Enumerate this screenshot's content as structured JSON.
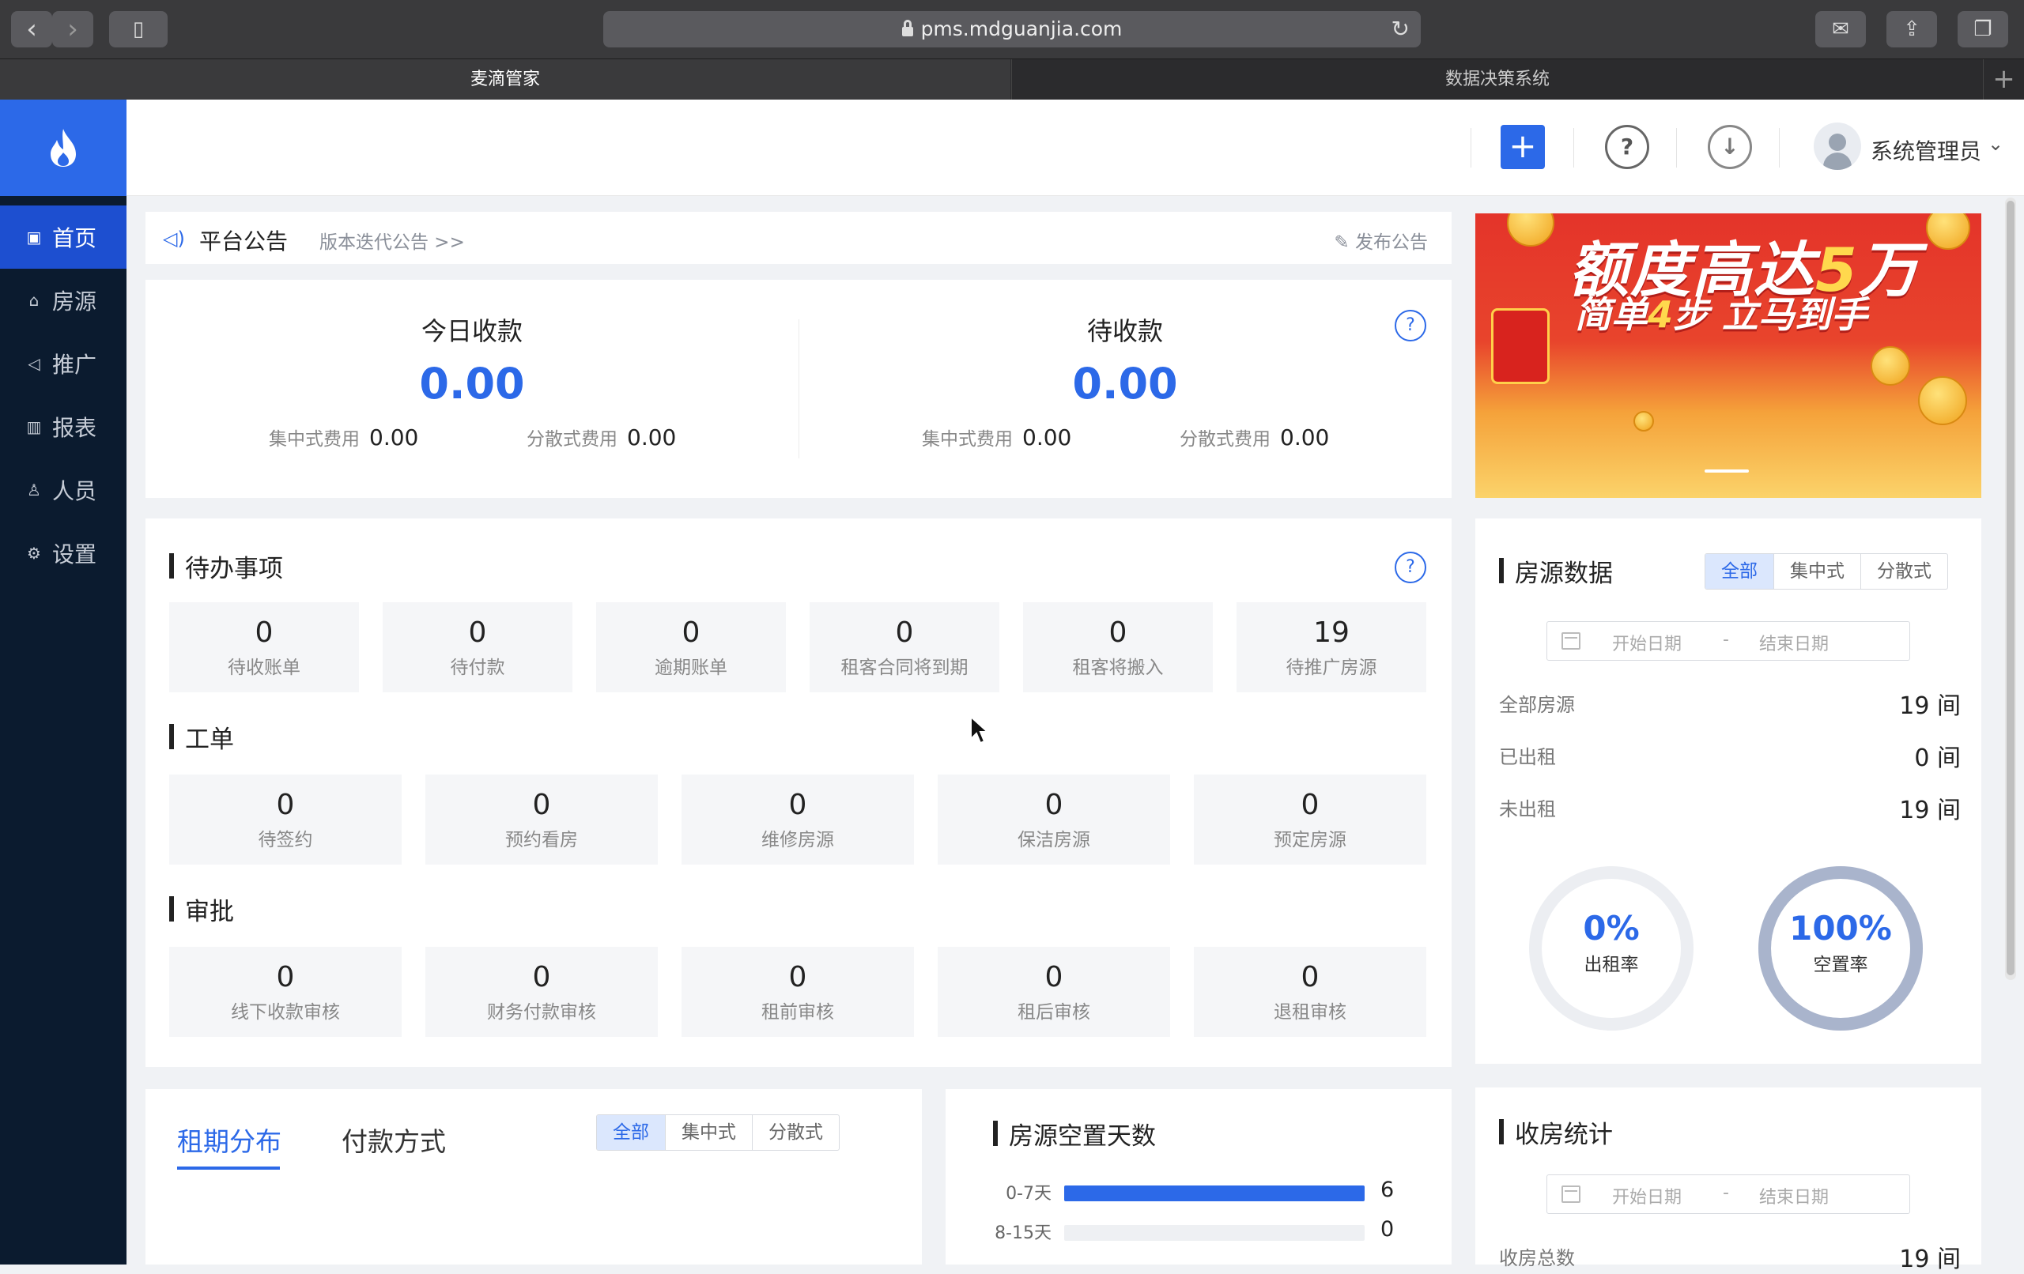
{
  "browser": {
    "url": "pms.mdguanjia.com",
    "tabs": [
      "麦滴管家",
      "数据决策系统"
    ]
  },
  "sidebar": {
    "items": [
      {
        "label": "首页",
        "icon": "dashboard-icon"
      },
      {
        "label": "房源",
        "icon": "home-icon"
      },
      {
        "label": "推广",
        "icon": "megaphone-icon"
      },
      {
        "label": "报表",
        "icon": "bar-chart-icon"
      },
      {
        "label": "人员",
        "icon": "user-icon"
      },
      {
        "label": "设置",
        "icon": "gear-icon"
      }
    ]
  },
  "header": {
    "user_name": "系统管理员"
  },
  "notice": {
    "title": "平台公告",
    "link": "版本迭代公告 >>",
    "publish": "发布公告"
  },
  "income": {
    "today": {
      "title": "今日收款",
      "value": "0.00",
      "central_label": "集中式费用",
      "central_value": "0.00",
      "scattered_label": "分散式费用",
      "scattered_value": "0.00"
    },
    "pending": {
      "title": "待收款",
      "value": "0.00",
      "central_label": "集中式费用",
      "central_value": "0.00",
      "scattered_label": "分散式费用",
      "scattered_value": "0.00"
    }
  },
  "banner": {
    "line1_a": "额度高达",
    "line1_b": "5",
    "line1_c": "万",
    "line2_a": "简单",
    "line2_b": "4",
    "line2_c": "步 立马到手"
  },
  "todo": {
    "title": "待办事项",
    "items": [
      {
        "value": "0",
        "label": "待收账单"
      },
      {
        "value": "0",
        "label": "待付款"
      },
      {
        "value": "0",
        "label": "逾期账单"
      },
      {
        "value": "0",
        "label": "租客合同将到期"
      },
      {
        "value": "0",
        "label": "租客将搬入"
      },
      {
        "value": "19",
        "label": "待推广房源"
      }
    ]
  },
  "workorder": {
    "title": "工单",
    "items": [
      {
        "value": "0",
        "label": "待签约"
      },
      {
        "value": "0",
        "label": "预约看房"
      },
      {
        "value": "0",
        "label": "维修房源"
      },
      {
        "value": "0",
        "label": "保洁房源"
      },
      {
        "value": "0",
        "label": "预定房源"
      }
    ]
  },
  "approval": {
    "title": "审批",
    "items": [
      {
        "value": "0",
        "label": "线下收款审核"
      },
      {
        "value": "0",
        "label": "财务付款审核"
      },
      {
        "value": "0",
        "label": "租前审核"
      },
      {
        "value": "0",
        "label": "租后审核"
      },
      {
        "value": "0",
        "label": "退租审核"
      }
    ]
  },
  "house_data": {
    "title": "房源数据",
    "filters": [
      "全部",
      "集中式",
      "分散式"
    ],
    "date_start": "开始日期",
    "date_sep": "-",
    "date_end": "结束日期",
    "rows": [
      {
        "label": "全部房源",
        "value": "19 间"
      },
      {
        "label": "已出租",
        "value": "0 间"
      },
      {
        "label": "未出租",
        "value": "19 间"
      }
    ],
    "occupancy": {
      "percent": "0%",
      "label": "出租率",
      "fraction": 0
    },
    "vacancy": {
      "percent": "100%",
      "label": "空置率",
      "fraction": 1
    },
    "colors": {
      "ring_track": "#eceef2",
      "ring_fill": "#a9b4cc"
    }
  },
  "lease": {
    "tabs": [
      "租期分布",
      "付款方式"
    ],
    "filters": [
      "全部",
      "集中式",
      "分散式"
    ]
  },
  "vacancy_days": {
    "title": "房源空置天数",
    "max": 6,
    "rows": [
      {
        "label": "0-7天",
        "value": 6
      },
      {
        "label": "8-15天",
        "value": 0
      }
    ]
  },
  "collect": {
    "title": "收房统计",
    "date_start": "开始日期",
    "date_sep": "-",
    "date_end": "结束日期",
    "total_label": "收房总数",
    "total_value": "19 间"
  },
  "colors": {
    "accent": "#2c69e8",
    "sidebar": "#0b1b2f"
  }
}
